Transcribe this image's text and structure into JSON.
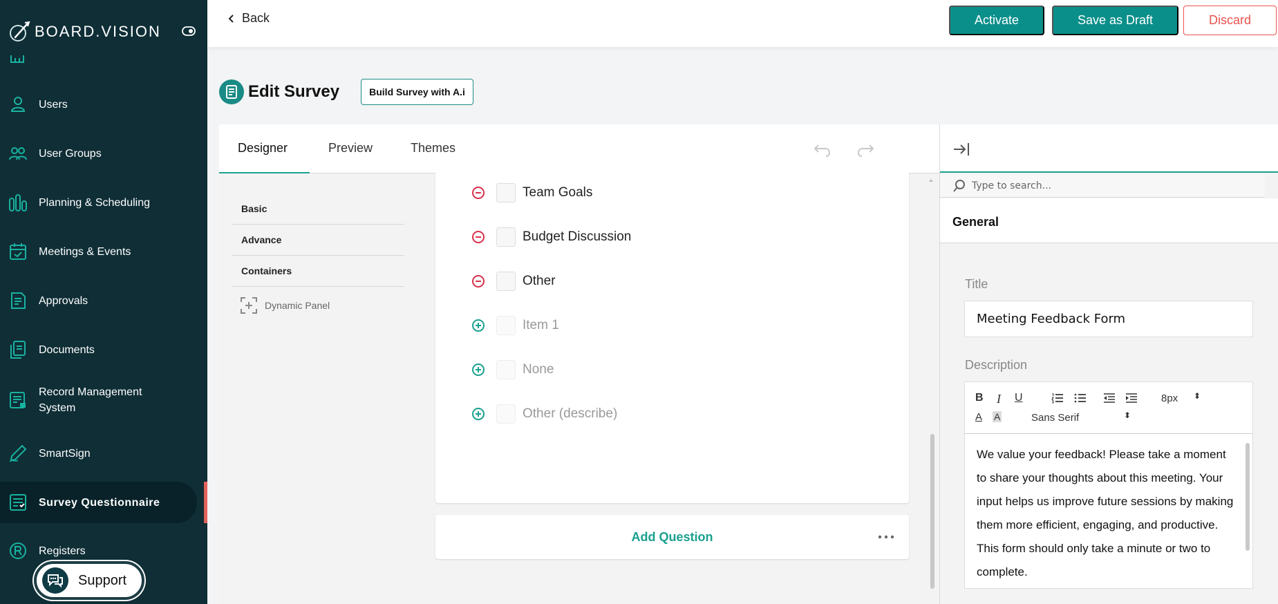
{
  "app": {
    "brand": "BOARD.VISION"
  },
  "sidebar": {
    "items": [
      {
        "label": "Users",
        "icon": "user-icon"
      },
      {
        "label": "User Groups",
        "icon": "users-icon"
      },
      {
        "label": "Planning & Scheduling",
        "icon": "chart-bars-icon"
      },
      {
        "label": "Meetings & Events",
        "icon": "calendar-check-icon"
      },
      {
        "label": "Approvals",
        "icon": "approval-doc-icon"
      },
      {
        "label": "Documents",
        "icon": "documents-icon"
      },
      {
        "label": "Record Management System",
        "icon": "record-icon"
      },
      {
        "label": "SmartSign",
        "icon": "pen-icon"
      },
      {
        "label": "Survey Questionnaire",
        "icon": "survey-icon",
        "active": true
      },
      {
        "label": "Registers",
        "icon": "registered-icon"
      }
    ],
    "support_label": "Support"
  },
  "topbar": {
    "back_label": "Back",
    "activate_label": "Activate",
    "save_draft_label": "Save as Draft",
    "discard_label": "Discard"
  },
  "header": {
    "title": "Edit Survey",
    "ai_button_label": "Build Survey with A.i"
  },
  "designer": {
    "tabs": [
      {
        "label": "Designer",
        "active": true
      },
      {
        "label": "Preview"
      },
      {
        "label": "Themes"
      }
    ],
    "toolbox": {
      "categories": [
        "Basic",
        "Advance",
        "Containers"
      ],
      "items": [
        {
          "label": "Dynamic Panel",
          "icon": "dynamic-panel-icon"
        }
      ]
    },
    "choices": [
      {
        "label": "Team Goals",
        "action": "remove"
      },
      {
        "label": "Budget Discussion",
        "action": "remove"
      },
      {
        "label": "Other",
        "action": "remove"
      },
      {
        "label": "Item 1",
        "action": "add"
      },
      {
        "label": "None",
        "action": "add"
      },
      {
        "label": "Other (describe)",
        "action": "add"
      }
    ],
    "add_question_label": "Add Question"
  },
  "properties": {
    "search_placeholder": "Type to search...",
    "section": "General",
    "title_label": "Title",
    "title_value": "Meeting Feedback Form",
    "description_label": "Description",
    "font_size": "8px",
    "font_family": "Sans Serif",
    "description_value": "We value your feedback! Please take a moment to share your thoughts about this meeting. Your input helps us improve future sessions by making them more efficient, engaging, and productive. This form should only take a minute or two to complete."
  },
  "colors": {
    "sidebar_bg": "#0f2e36",
    "accent": "#0b8f8a",
    "danger": "#e8524e",
    "remove_icon": "#d9304a",
    "add_icon": "#19a08f"
  }
}
